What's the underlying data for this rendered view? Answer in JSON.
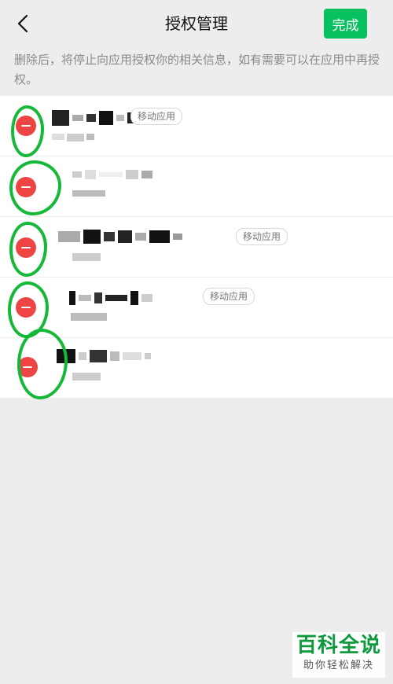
{
  "header": {
    "title": "授权管理",
    "done_label": "完成",
    "back_icon": "chevron-left-icon"
  },
  "hint": "删除后，将停止向应用授权你的相关信息，如有需要可以在应用中再授权。",
  "apps": [
    {
      "tag": "移动应用"
    },
    {
      "tag": ""
    },
    {
      "tag": "移动应用"
    },
    {
      "tag": "移动应用"
    },
    {
      "tag": ""
    }
  ],
  "watermark": {
    "title": "百科全说",
    "subtitle": "助你轻松解决"
  },
  "colors": {
    "accent": "#07c160",
    "remove": "#ee4444",
    "annotation": "#15b838"
  }
}
